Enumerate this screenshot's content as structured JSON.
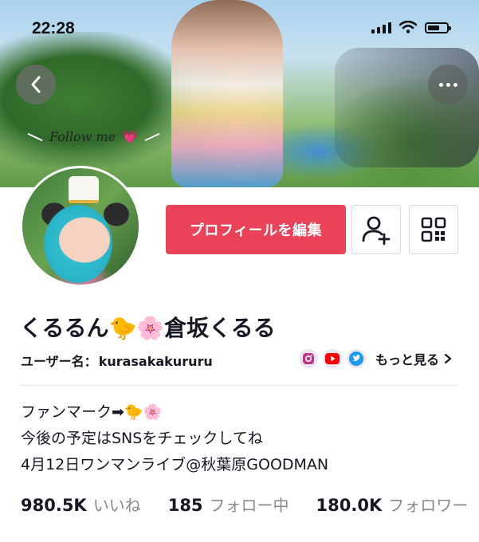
{
  "status_bar": {
    "time": "22:28"
  },
  "cover": {
    "overlay_text": "Follow me",
    "overlay_heart": "💗"
  },
  "actions": {
    "edit_profile": "プロフィールを編集",
    "add_friend_icon": "person-plus-icon",
    "qr_icon": "qr-code-icon"
  },
  "profile": {
    "display_name": "くるるん🐤🌸倉坂くるる",
    "username_label": "ユーザー名：",
    "username": "kurasakakururu",
    "more_link": "もっと見る"
  },
  "bio": {
    "lines": [
      "ファンマーク➡🐤🌸",
      "今後の予定はSNSをチェックしてね",
      "4月12日ワンマンライブ@秋葉原GOODMAN"
    ]
  },
  "stats": [
    {
      "value": "980.5K",
      "label": "いいね"
    },
    {
      "value": "185",
      "label": "フォロー中"
    },
    {
      "value": "180.0K",
      "label": "フォロワー"
    }
  ],
  "colors": {
    "accent": "#ea4359",
    "text": "#161823",
    "muted": "#8a8b91"
  }
}
